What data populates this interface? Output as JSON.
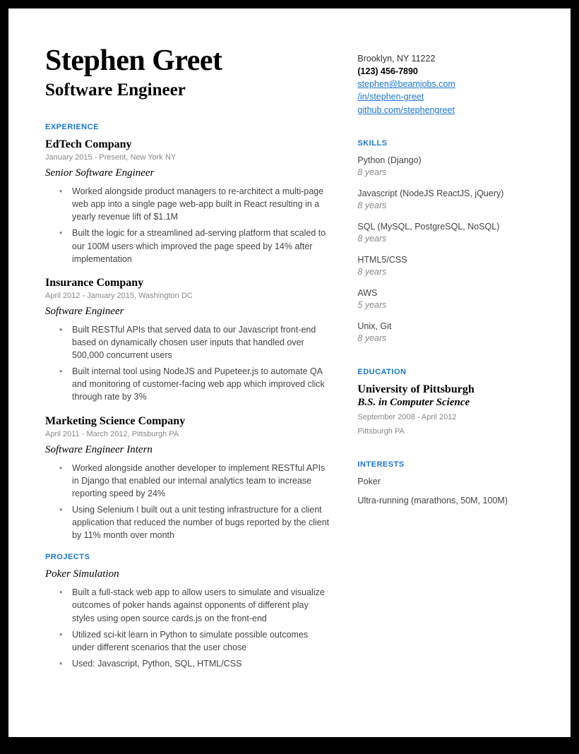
{
  "header": {
    "name": "Stephen Greet",
    "title": "Software Engineer"
  },
  "contact": {
    "location": "Brooklyn, NY 11222",
    "phone": "(123) 456-7890",
    "email": "stephen@beamjobs.com",
    "linkedin": "/in/stephen-greet",
    "github": "github.com/stephengreet"
  },
  "sections": {
    "experience": "EXPERIENCE",
    "projects": "PROJECTS",
    "skills": "SKILLS",
    "education": "EDUCATION",
    "interests": "INTERESTS"
  },
  "experience": [
    {
      "company": "EdTech Company",
      "meta": "January 2015 - Present, New York NY",
      "role": "Senior Software Engineer",
      "bullets": [
        "Worked alongside product managers to re-architect a multi-page web app into a single page web-app built in React resulting in a yearly revenue lift of $1.1M",
        "Built the logic for  a streamlined ad-serving platform that scaled to our 100M users which improved the page speed by 14% after implementation"
      ]
    },
    {
      "company": "Insurance Company",
      "meta": "April 2012 - January 2015, Washington DC",
      "role": "Software Engineer",
      "bullets": [
        "Built RESTful APIs that served data to our Javascript front-end based on dynamically chosen user inputs that handled over 500,000 concurrent users",
        "Built internal tool using NodeJS and Pupeteer.js to automate QA and monitoring of customer-facing web app which improved click through rate by 3%"
      ]
    },
    {
      "company": "Marketing Science Company",
      "meta": "April 2011 - March 2012, Pittsburgh PA",
      "role": "Software Engineer Intern",
      "bullets": [
        "Worked alongside another developer to implement RESTful APIs in Django that enabled our internal analytics team to increase reporting speed by 24%",
        "Using Selenium I built out a unit testing infrastructure for a client application that reduced the number of bugs reported by the client by 11% month over month"
      ]
    }
  ],
  "projects": [
    {
      "name": "Poker Simulation",
      "bullets": [
        "Built a full-stack web app to allow users to simulate and visualize outcomes of poker hands against opponents of different play styles using open source cards.js on the front-end",
        "Utilized  sci-kit learn in Python to simulate possible outcomes under different scenarios that the user chose",
        "Used: Javascript, Python, SQL, HTML/CSS"
      ]
    }
  ],
  "skills": [
    {
      "name": "Python (Django)",
      "years": "8 years"
    },
    {
      "name": "Javascript (NodeJS ReactJS, jQuery)",
      "years": "8 years"
    },
    {
      "name": "SQL  (MySQL, PostgreSQL, NoSQL)",
      "years": "8 years"
    },
    {
      "name": "HTML5/CSS",
      "years": "8 years"
    },
    {
      "name": "AWS",
      "years": "5 years"
    },
    {
      "name": "Unix, Git",
      "years": "8 years"
    }
  ],
  "education": {
    "school": "University of Pittsburgh",
    "degree": "B.S. in Computer Science",
    "dates": "September 2008 - April 2012",
    "location": "Pittsburgh PA"
  },
  "interests": [
    "Poker",
    "Ultra-running (marathons, 50M, 100M)"
  ]
}
